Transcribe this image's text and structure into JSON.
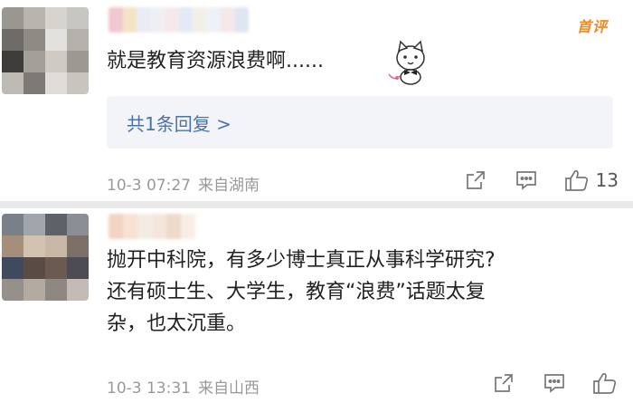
{
  "comments": [
    {
      "badge": "首评",
      "text": "就是教育资源浪费啊......",
      "reply_link": "共1条回复 >",
      "time": "10-3 07:27",
      "location": "来自湖南",
      "likes": "13",
      "avatar_colors": [
        "#9a9690",
        "#b9b4ad",
        "#d7d4cf",
        "#c8c6c1",
        "#6f6c67",
        "#8e8a84",
        "#e3e1dd",
        "#b4b1ab",
        "#3e3c39",
        "#a29e98",
        "#cfcac3",
        "#9c9892",
        "#bdb9b3",
        "#7d7974",
        "#e0ddd8",
        "#c9c5be"
      ],
      "name_colors": [
        "#f1c8cf",
        "#f4e4c6",
        "#e9ecf4",
        "#eef0f3",
        "#f6e9ec",
        "#e4eaf5",
        "#f2efe6",
        "#eef2f8",
        "#f5e8ea",
        "#dfe6f2"
      ]
    },
    {
      "text_lines": [
        "抛开中科院，有多少博士真正从事科学研究?",
        "还有硕士生、大学生，教育“浪费”话题太复",
        "杂，也太沉重。"
      ],
      "time": "10-3 13:31",
      "location": "来自山西",
      "avatar_colors": [
        "#7a8087",
        "#a1a6ac",
        "#5d6268",
        "#8b8f95",
        "#a58f7b",
        "#d2c2b0",
        "#c9b7a5",
        "#7b6f66",
        "#3f4a5e",
        "#5a4b45",
        "#6b5a50",
        "#4d4c54",
        "#97908a",
        "#b3aaa1",
        "#8e8782",
        "#c4bcb4"
      ],
      "name_colors": [
        "#f3d3c3",
        "#f7e2d3",
        "#f2ece4",
        "#f5e6dc",
        "#efd9c9",
        "#f8eee6"
      ]
    }
  ]
}
